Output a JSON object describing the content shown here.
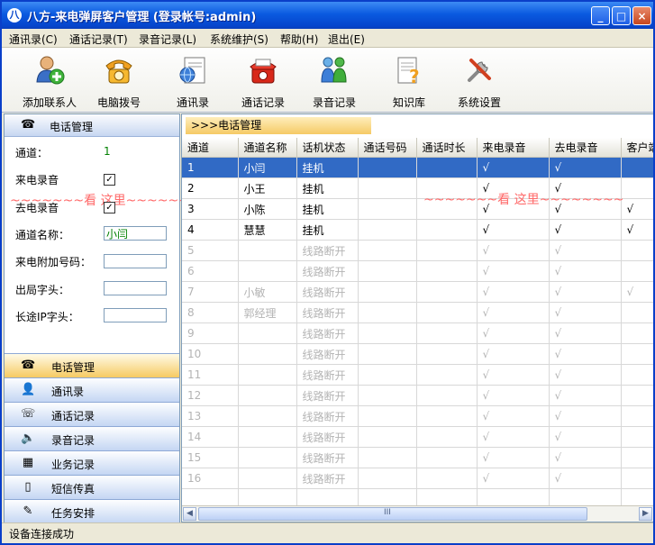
{
  "window": {
    "title": "八方-来电弹屏客户管理 (登录帐号:admin)",
    "buttons": {
      "minimize": "_",
      "maximize": "□",
      "close": "×"
    }
  },
  "menu": [
    "通讯录(C)",
    "通话记录(T)",
    "录音记录(L)",
    "系统维护(S)",
    "帮助(H)",
    "退出(E)"
  ],
  "toolbar": [
    {
      "label": "添加联系人",
      "icon": "add-contact-icon"
    },
    {
      "label": "电脑拨号",
      "icon": "phone-dial-icon"
    },
    {
      "label": "通讯录",
      "icon": "address-book-icon"
    },
    {
      "label": "通话记录",
      "icon": "call-log-icon"
    },
    {
      "label": "录音记录",
      "icon": "recording-icon"
    },
    {
      "label": "知识库",
      "icon": "knowledge-base-icon"
    },
    {
      "label": "系统设置",
      "icon": "settings-icon"
    }
  ],
  "left_panel": {
    "header": "电话管理",
    "channel_label": "通道：",
    "channel_value": "1",
    "incoming_record_label": "来电录音",
    "outgoing_record_label": "去电录音",
    "channel_name_label": "通道名称：",
    "channel_name_value": "小闫",
    "extra_number_label": "来电附加号码：",
    "outbound_prefix_label": "出局字头：",
    "ip_prefix_label": "长途IP字头：",
    "watermark": "~~~~~~~看 这里~~~~~~~~",
    "nav": [
      {
        "label": "电话管理",
        "icon": "phone-icon",
        "active": true
      },
      {
        "label": "通讯录",
        "icon": "contact-icon",
        "active": false
      },
      {
        "label": "通话记录",
        "icon": "call-record-icon",
        "active": false
      },
      {
        "label": "录音记录",
        "icon": "speaker-icon",
        "active": false
      },
      {
        "label": "业务记录",
        "icon": "calendar-icon",
        "active": false
      },
      {
        "label": "短信传真",
        "icon": "mobile-icon",
        "active": false
      },
      {
        "label": "任务安排",
        "icon": "task-icon",
        "active": false
      }
    ]
  },
  "right_panel": {
    "breadcrumb": ">>>电话管理",
    "watermark": "~~~~~~~看 这里~~~~~~~~",
    "columns": [
      "通道",
      "通道名称",
      "话机状态",
      "通话号码",
      "通话时长",
      "来电录音",
      "去电录音",
      "客户端"
    ],
    "rows": [
      {
        "ch": "1",
        "name": "小闫",
        "state": "挂机",
        "num": "",
        "dur": "",
        "in": "√",
        "out": "√",
        "client": "",
        "online": true,
        "selected": true
      },
      {
        "ch": "2",
        "name": "小王",
        "state": "挂机",
        "num": "",
        "dur": "",
        "in": "√",
        "out": "√",
        "client": "",
        "online": true,
        "selected": false
      },
      {
        "ch": "3",
        "name": "小陈",
        "state": "挂机",
        "num": "",
        "dur": "",
        "in": "√",
        "out": "√",
        "client": "√",
        "online": true,
        "selected": false
      },
      {
        "ch": "4",
        "name": "慧慧",
        "state": "挂机",
        "num": "",
        "dur": "",
        "in": "√",
        "out": "√",
        "client": "√",
        "online": true,
        "selected": false
      },
      {
        "ch": "5",
        "name": "",
        "state": "线路断开",
        "num": "",
        "dur": "",
        "in": "√",
        "out": "√",
        "client": "",
        "online": false,
        "selected": false
      },
      {
        "ch": "6",
        "name": "",
        "state": "线路断开",
        "num": "",
        "dur": "",
        "in": "√",
        "out": "√",
        "client": "",
        "online": false,
        "selected": false
      },
      {
        "ch": "7",
        "name": "小敏",
        "state": "线路断开",
        "num": "",
        "dur": "",
        "in": "√",
        "out": "√",
        "client": "√",
        "online": false,
        "selected": false
      },
      {
        "ch": "8",
        "name": "郭经理",
        "state": "线路断开",
        "num": "",
        "dur": "",
        "in": "√",
        "out": "√",
        "client": "",
        "online": false,
        "selected": false
      },
      {
        "ch": "9",
        "name": "",
        "state": "线路断开",
        "num": "",
        "dur": "",
        "in": "√",
        "out": "√",
        "client": "",
        "online": false,
        "selected": false
      },
      {
        "ch": "10",
        "name": "",
        "state": "线路断开",
        "num": "",
        "dur": "",
        "in": "√",
        "out": "√",
        "client": "",
        "online": false,
        "selected": false
      },
      {
        "ch": "11",
        "name": "",
        "state": "线路断开",
        "num": "",
        "dur": "",
        "in": "√",
        "out": "√",
        "client": "",
        "online": false,
        "selected": false
      },
      {
        "ch": "12",
        "name": "",
        "state": "线路断开",
        "num": "",
        "dur": "",
        "in": "√",
        "out": "√",
        "client": "",
        "online": false,
        "selected": false
      },
      {
        "ch": "13",
        "name": "",
        "state": "线路断开",
        "num": "",
        "dur": "",
        "in": "√",
        "out": "√",
        "client": "",
        "online": false,
        "selected": false
      },
      {
        "ch": "14",
        "name": "",
        "state": "线路断开",
        "num": "",
        "dur": "",
        "in": "√",
        "out": "√",
        "client": "",
        "online": false,
        "selected": false
      },
      {
        "ch": "15",
        "name": "",
        "state": "线路断开",
        "num": "",
        "dur": "",
        "in": "√",
        "out": "√",
        "client": "",
        "online": false,
        "selected": false
      },
      {
        "ch": "16",
        "name": "",
        "state": "线路断开",
        "num": "",
        "dur": "",
        "in": "√",
        "out": "√",
        "client": "",
        "online": false,
        "selected": false
      }
    ],
    "scroll_grip": "III"
  },
  "status": "设备连接成功",
  "colors": {
    "title_bar": "#0a5ae0",
    "selection": "#316ac5",
    "watermark": "#ff6a6a",
    "active_nav": "#f6ca62",
    "offline_text": "#b4b4b4"
  }
}
